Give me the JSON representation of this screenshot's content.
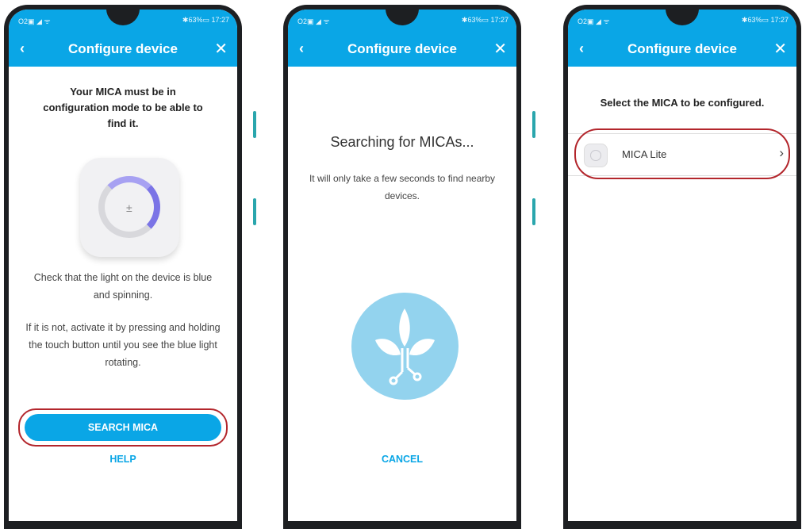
{
  "status": {
    "left": "O2▣ ◢ ᯤ",
    "right": "✱63%▭ 17:27"
  },
  "appbar": {
    "title": "Configure device",
    "back_icon": "‹",
    "close_icon": "✕"
  },
  "screen1": {
    "heading": "Your MICA must be in configuration mode to be able to find it.",
    "note1": "Check that the light on the device is blue and spinning.",
    "note2": "If it is not, activate it by pressing and holding the touch button until you see the blue light rotating.",
    "button": "SEARCH MICA",
    "help": "HELP"
  },
  "screen2": {
    "title": "Searching for MICAs...",
    "note": "It will only take a few seconds to find nearby devices.",
    "cancel": "CANCEL"
  },
  "screen3": {
    "heading": "Select the MICA to be configured.",
    "item_label": "MICA Lite",
    "chevron": "›"
  },
  "colors": {
    "accent": "#0aa6e6",
    "highlight": "#b3262c",
    "plant_bg": "#93d3ee"
  }
}
